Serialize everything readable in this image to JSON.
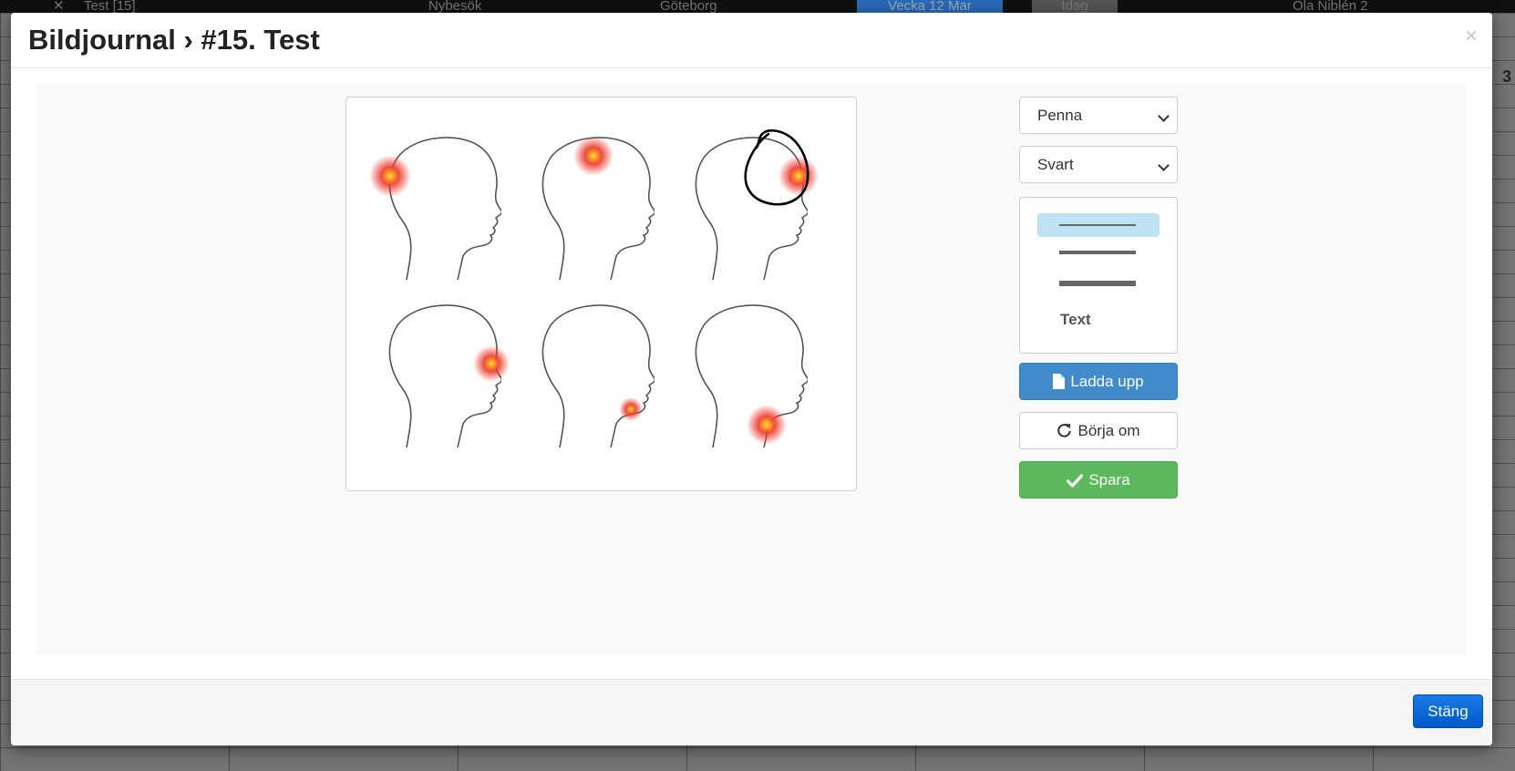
{
  "background": {
    "topbar": [
      "Test [15]",
      "Nybesök",
      "Göteborg",
      "Vecka 12 Mar",
      "Idag",
      "Ola Niblén 2"
    ],
    "edge_number": "3"
  },
  "modal": {
    "title": "Bildjournal › #15. Test",
    "close_symbol": "×"
  },
  "tools": {
    "tool_select": {
      "value": "Penna"
    },
    "color_select": {
      "value": "Svart"
    },
    "pen_sizes": [
      "thin",
      "medium",
      "thick"
    ],
    "selected_pen_size": "thin",
    "text_option": "Text",
    "upload_label": "Ladda upp",
    "reset_label": "Börja om",
    "save_label": "Spara"
  },
  "canvas": {
    "image": "six-head-profiles-pain-locations",
    "highlight_color": "#e8302a",
    "annotation_color": "#000000"
  },
  "footer": {
    "close_label": "Stäng"
  },
  "colors": {
    "primary": "#428bca",
    "success": "#5cb85c",
    "close_button": "#0a6bd9",
    "selected_pen": "#bde3f5"
  }
}
